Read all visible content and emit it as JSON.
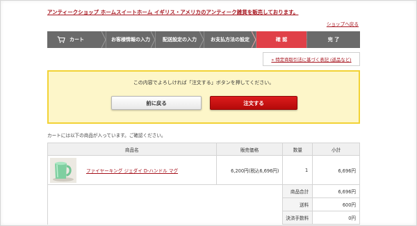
{
  "header": {
    "title_link": "アンティークショップ ホームスイートホーム イギリス・アメリカのアンティーク雑貨を販売しております。",
    "shop_link": "ショップへ戻る"
  },
  "steps": [
    {
      "label": "カート"
    },
    {
      "label": "お客様情報の入力"
    },
    {
      "label": "配送設定の入力"
    },
    {
      "label": "お支払方法の設定"
    },
    {
      "label": "確 認"
    },
    {
      "label": "完 了"
    }
  ],
  "notice_link": "» 特定商取引法に基づく表記 (返品など)",
  "confirm": {
    "message": "この内容でよろしければ「注文する」ボタンを押してください。",
    "back_label": "前に戻る",
    "order_label": "注文する"
  },
  "cart_note": "カートには以下の商品が入っています。ご確認ください。",
  "table": {
    "headers": [
      "商品名",
      "販売価格",
      "数量",
      "小計"
    ],
    "rows": [
      {
        "name": "ファイヤーキング ジェダイ D-ハンドル マグ",
        "price": "6,200円(税込6,696円)",
        "quantity": "1",
        "subtotal": "6,696円"
      }
    ]
  },
  "summary": [
    {
      "label": "商品合計",
      "value": "6,696円"
    },
    {
      "label": "送料",
      "value": "600円"
    },
    {
      "label": "決済手数料",
      "value": "0円"
    }
  ],
  "colors": {
    "link_red": "#a5121c",
    "step_gray": "#6a6a6a",
    "step_active": "#e04048",
    "confirm_bg": "#fdf6c9",
    "confirm_border": "#f2d234",
    "order_button": "#c8100f"
  }
}
